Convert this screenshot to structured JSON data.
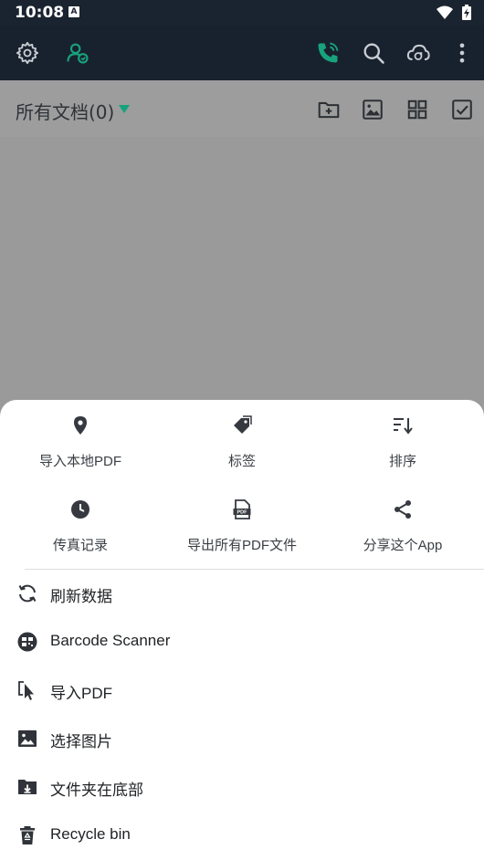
{
  "status_bar": {
    "time": "10:08",
    "notification_glyph": "A"
  },
  "toolbar": {
    "icons": [
      "gear-icon",
      "contacts-icon",
      "phone-icon",
      "search-icon",
      "cloud-sync-icon",
      "more-vert-icon"
    ],
    "accent_color": "#18a37c"
  },
  "doc_header": {
    "title": "所有文档(0)",
    "icons": [
      "new-folder-icon",
      "image-icon",
      "grid-view-icon",
      "select-check-icon"
    ]
  },
  "sheet": {
    "grid": [
      {
        "label": "导入本地PDF",
        "icon": "location-pin-icon"
      },
      {
        "label": "标签",
        "icon": "tag-icon"
      },
      {
        "label": "排序",
        "icon": "sort-icon"
      },
      {
        "label": "传真记录",
        "icon": "clock-icon"
      },
      {
        "label": "导出所有PDF文件",
        "icon": "pdf-file-icon"
      },
      {
        "label": "分享这个App",
        "icon": "share-icon"
      }
    ],
    "list": [
      {
        "label": "刷新数据",
        "icon": "refresh-icon"
      },
      {
        "label": "Barcode Scanner",
        "icon": "barcode-scanner-icon"
      },
      {
        "label": "导入PDF",
        "icon": "import-cursor-icon"
      },
      {
        "label": "选择图片",
        "icon": "picture-icon"
      },
      {
        "label": "文件夹在底部",
        "icon": "folder-download-icon"
      },
      {
        "label": "Recycle bin",
        "icon": "recycle-bin-icon"
      }
    ]
  }
}
